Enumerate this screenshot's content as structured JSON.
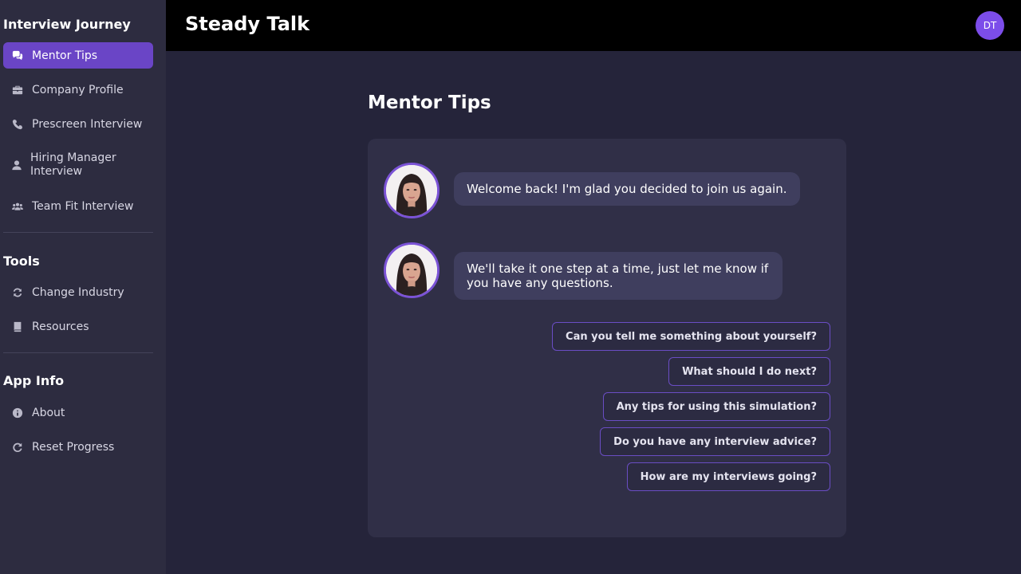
{
  "app": {
    "title": "Steady Talk",
    "user_initials": "DT"
  },
  "sidebar": {
    "sections": [
      {
        "title": "Interview Journey"
      },
      {
        "title": "Tools"
      },
      {
        "title": "App Info"
      }
    ],
    "journey_items": [
      {
        "label": "Mentor Tips",
        "icon": "comments-icon",
        "active": true
      },
      {
        "label": "Company Profile",
        "icon": "briefcase-icon"
      },
      {
        "label": "Prescreen Interview",
        "icon": "phone-icon"
      },
      {
        "label": "Hiring Manager Interview",
        "icon": "user-icon"
      },
      {
        "label": "Team Fit Interview",
        "icon": "users-icon"
      }
    ],
    "tools_items": [
      {
        "label": "Change Industry",
        "icon": "sync-icon"
      },
      {
        "label": "Resources",
        "icon": "book-icon"
      }
    ],
    "info_items": [
      {
        "label": "About",
        "icon": "info-icon"
      },
      {
        "label": "Reset Progress",
        "icon": "redo-icon"
      }
    ]
  },
  "main": {
    "title": "Mentor Tips",
    "messages": [
      {
        "text": "Welcome back! I'm glad you decided to join us again."
      },
      {
        "text": "We'll take it one step at a time, just let me know if you have any questions."
      }
    ],
    "suggestions": [
      "Can you tell me something about yourself?",
      "What should I do next?",
      "Any tips for using this simulation?",
      "Do you have any interview advice?",
      "How are my interviews going?"
    ]
  },
  "colors": {
    "accent": "#6a45c6",
    "sidebar_bg": "#2d2c40",
    "main_bg": "#25243a",
    "panel_bg": "#302f47",
    "bubble_bg": "#3f3e5e",
    "header_bg": "#000000"
  }
}
